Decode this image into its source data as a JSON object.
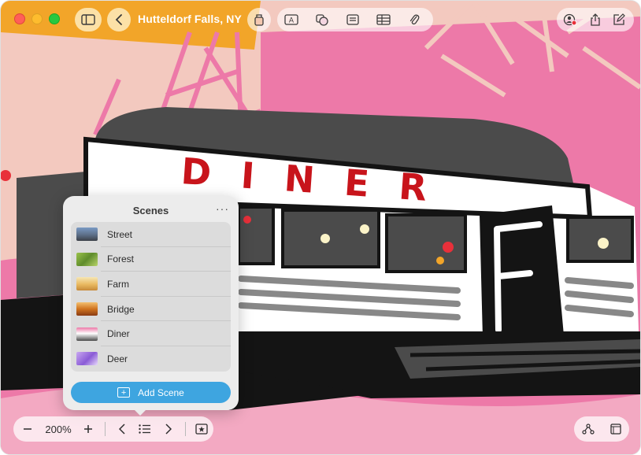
{
  "window": {
    "title": "Hutteldorf Falls, NY",
    "traffic_lights": [
      "close",
      "minimize",
      "zoom"
    ]
  },
  "toolbar": {
    "sidebar_icon": "sidebar-icon",
    "back_icon": "chevron-left-icon",
    "center_tools": [
      "text-box-icon",
      "shapes-icon",
      "sticky-note-icon",
      "table-icon",
      "attachment-icon"
    ],
    "right_tools": [
      "collaborate-icon",
      "share-icon",
      "compose-icon"
    ]
  },
  "canvas": {
    "sign_text": "DINER",
    "colors": {
      "pink": "#ed79a8",
      "peach": "#f3c9bf",
      "orange": "#f2a529",
      "dark_gray": "#4b4b4b",
      "red": "#c8141b"
    }
  },
  "scenes": {
    "title": "Scenes",
    "more_label": "···",
    "items": [
      {
        "label": "Street"
      },
      {
        "label": "Forest"
      },
      {
        "label": "Farm"
      },
      {
        "label": "Bridge"
      },
      {
        "label": "Diner"
      },
      {
        "label": "Deer"
      }
    ],
    "add_label": "Add Scene"
  },
  "bottom": {
    "zoom_label": "200%",
    "zoom_out": "minus-icon",
    "zoom_in": "plus-icon",
    "prev": "chevron-left-icon",
    "list": "list-icon",
    "next": "chevron-right-icon",
    "scene_marker": "star-box-icon",
    "connect": "connector-icon",
    "frame": "frame-icon"
  }
}
